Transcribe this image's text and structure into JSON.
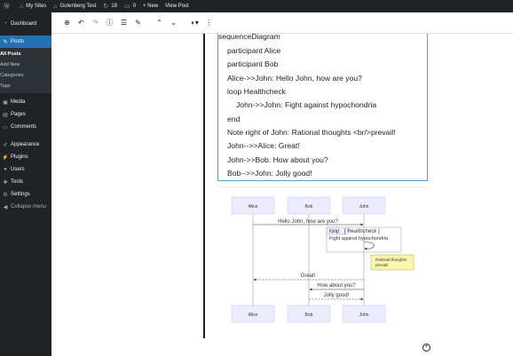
{
  "adminbar": {
    "wp_logo": "wordpress-icon",
    "my_sites": "My Sites",
    "site_name": "Gutenberg Test",
    "updates_count": "18",
    "comments_count": "0",
    "new_label": "+ New",
    "view_post": "View Post"
  },
  "sidebar": {
    "dashboard": "Dashboard",
    "posts": "Posts",
    "submenu": [
      "All Posts",
      "Add New",
      "Categories",
      "Tags"
    ],
    "media": "Media",
    "pages": "Pages",
    "comments": "Comments",
    "appearance": "Appearance",
    "plugins": "Plugins",
    "users": "Users",
    "tools": "Tools",
    "settings": "Settings",
    "collapse": "Collapse menu"
  },
  "toolbar": {
    "icons": [
      "add-block-icon",
      "undo-icon",
      "redo-icon",
      "info-icon",
      "list-view-icon",
      "edit-icon",
      "move-up-icon",
      "move-down-icon",
      "block-type-icon",
      "more-options-icon"
    ]
  },
  "code": {
    "lines": [
      "sequenceDiagram",
      "participant Alice",
      "participant Bob",
      "Alice->>John: Hello John, how are you?",
      "loop Healthcheck",
      "John->>John: Fight against hypochondria",
      "end",
      "Note right of John: Rational thoughts <br/>prevail!",
      "John-->>Alice: Great!",
      "John->>Bob: How about you?",
      "Bob-->>John: Jolly good!"
    ]
  },
  "diagram": {
    "actors": [
      "Alice",
      "Bob",
      "John"
    ],
    "msg1": "Hello John, how are you?",
    "loop_label": "loop",
    "loop_title": "[ Healthcheck ]",
    "loop_msg": "Fight against hypochondria",
    "note_line1": "Rational thoughts",
    "note_line2": "prevail!",
    "msg_great": "Great!",
    "msg_how": "How about you?",
    "msg_jolly": "Jolly good!"
  }
}
